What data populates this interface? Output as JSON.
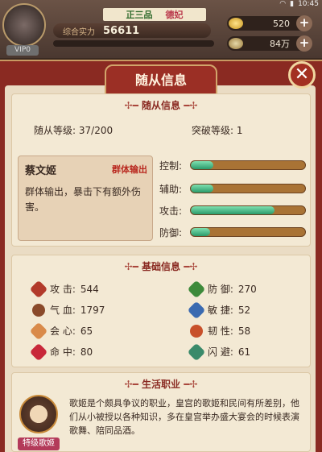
{
  "hud": {
    "status_time": "10:45",
    "vip": "VIP0",
    "rank": "正三品",
    "rank_title": "德妃",
    "power_label": "综合实力",
    "power_value": "56611",
    "ingots": "520",
    "silver": "84万"
  },
  "panel": {
    "title": "随从信息",
    "close_label": "✕"
  },
  "info": {
    "section_title": "随从信息",
    "level_label": "随从等级:",
    "level_value": "37/200",
    "break_label": "突破等级:",
    "break_value": "1"
  },
  "companion": {
    "name": "蔡文姬",
    "role_tag": "群体输出",
    "description": "群体输出，暴击下有额外伤害。"
  },
  "abilities": [
    {
      "label": "控制:",
      "fill": 0.2
    },
    {
      "label": "辅助:",
      "fill": 0.2
    },
    {
      "label": "攻击:",
      "fill": 0.73
    },
    {
      "label": "防御:",
      "fill": 0.17
    }
  ],
  "basic": {
    "section_title": "基础信息",
    "attrs": [
      {
        "label": "攻 击:",
        "value": "544",
        "icon": "attack-icon",
        "color": "#b23a2a"
      },
      {
        "label": "防 御:",
        "value": "270",
        "icon": "defense-icon",
        "color": "#3d8a3a"
      },
      {
        "label": "气 血:",
        "value": "1797",
        "icon": "health-icon",
        "color": "#8a4a2a"
      },
      {
        "label": "敏 捷:",
        "value": "52",
        "icon": "agility-icon",
        "color": "#3a6ab0"
      },
      {
        "label": "会 心:",
        "value": "65",
        "icon": "critical-icon",
        "color": "#d98a4a"
      },
      {
        "label": "韧 性:",
        "value": "58",
        "icon": "toughness-icon",
        "color": "#c8502a"
      },
      {
        "label": "命 中:",
        "value": "80",
        "icon": "accuracy-icon",
        "color": "#c8283a"
      },
      {
        "label": "闪 避:",
        "value": "61",
        "icon": "dodge-icon",
        "color": "#3a8a6a"
      }
    ]
  },
  "life": {
    "section_title": "生活职业",
    "badge": "特级歌姬",
    "description": "歌姬是个颇具争议的职业，皇宫的歌姬和民间有所差别，他们从小被授以各种知识，多在皇宫举办盛大宴会的时候表演歌舞、陪同品酒。"
  }
}
